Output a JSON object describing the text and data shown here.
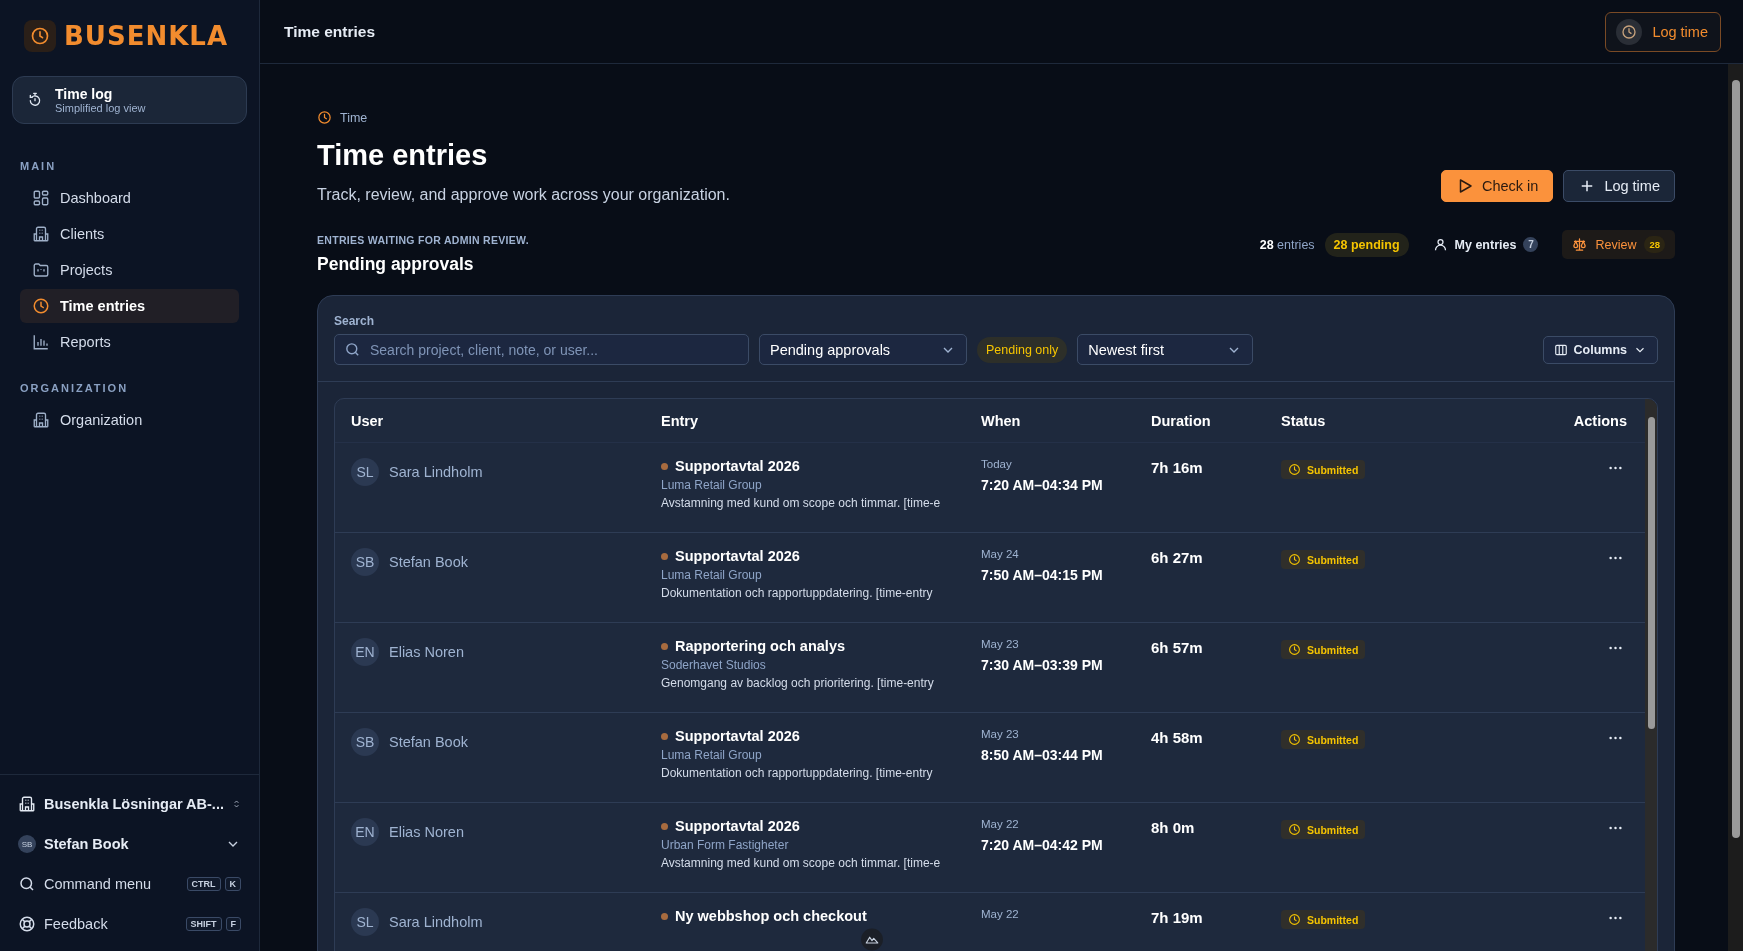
{
  "brand": {
    "name": "BUSENKLA"
  },
  "sidebar": {
    "feature_card": {
      "title": "Time log",
      "subtitle": "Simplified log view"
    },
    "sections": [
      {
        "heading": "MAIN",
        "items": [
          {
            "label": "Dashboard",
            "kind": "grid",
            "selected": false
          },
          {
            "label": "Clients",
            "kind": "building",
            "selected": false
          },
          {
            "label": "Projects",
            "kind": "folder",
            "selected": false
          },
          {
            "label": "Time entries",
            "kind": "clock",
            "selected": true
          },
          {
            "label": "Reports",
            "kind": "chart",
            "selected": false
          }
        ]
      },
      {
        "heading": "ORGANIZATION",
        "items": [
          {
            "label": "Organization",
            "kind": "building",
            "selected": false
          }
        ]
      }
    ],
    "org_switcher": "Busenkla Lösningar AB-...",
    "user": {
      "initials": "SB",
      "name": "Stefan Book"
    },
    "shortcuts": [
      {
        "label": "Command menu",
        "kind": "search",
        "keys": [
          "CTRL",
          "K"
        ]
      },
      {
        "label": "Feedback",
        "kind": "lifebuoy",
        "keys": [
          "SHIFT",
          "F"
        ]
      }
    ]
  },
  "header": {
    "title": "Time entries",
    "button": "Log time"
  },
  "page": {
    "eyebrow": "Time",
    "title": "Time entries",
    "subtitle": "Track, review, and approve work across your organization.",
    "primary_button": "Check in",
    "secondary_button": "Log time",
    "section_kicker": "ENTRIES WAITING FOR ADMIN REVIEW.",
    "section_title": "Pending approvals",
    "stats": {
      "count": "28",
      "count_label": "entries",
      "pending": "28 pending",
      "my_entries": "My entries",
      "my_count": "7",
      "review": "Review",
      "review_count": "28"
    }
  },
  "filters": {
    "search_label": "Search",
    "search_placeholder": "Search project, client, note, or user...",
    "view": "Pending approvals",
    "pending_only": "Pending only",
    "sort": "Newest first",
    "columns_button": "Columns"
  },
  "table": {
    "columns": [
      "User",
      "Entry",
      "When",
      "Duration",
      "Status",
      "Actions"
    ],
    "rows": [
      {
        "initials": "SL",
        "user": "Sara Lindholm",
        "project": "Supportavtal 2026",
        "color": "#a86b3f",
        "client": "Luma Retail Group",
        "note": "Avstamning med kund om scope och timmar. [time-e",
        "day": "Today",
        "time": "7:20 AM–04:34 PM",
        "duration": "7h 16m",
        "status": "Submitted"
      },
      {
        "initials": "SB",
        "user": "Stefan Book",
        "project": "Supportavtal 2026",
        "color": "#a86b3f",
        "client": "Luma Retail Group",
        "note": "Dokumentation och rapportuppdatering. [time-entry",
        "day": "May 24",
        "time": "7:50 AM–04:15 PM",
        "duration": "6h 27m",
        "status": "Submitted"
      },
      {
        "initials": "EN",
        "user": "Elias Noren",
        "project": "Rapportering och analys",
        "color": "#a86b3f",
        "client": "Soderhavet Studios",
        "note": "Genomgang av backlog och prioritering. [time-entry",
        "day": "May 23",
        "time": "7:30 AM–03:39 PM",
        "duration": "6h 57m",
        "status": "Submitted"
      },
      {
        "initials": "SB",
        "user": "Stefan Book",
        "project": "Supportavtal 2026",
        "color": "#a86b3f",
        "client": "Luma Retail Group",
        "note": "Dokumentation och rapportuppdatering. [time-entry",
        "day": "May 23",
        "time": "8:50 AM–03:44 PM",
        "duration": "4h 58m",
        "status": "Submitted"
      },
      {
        "initials": "EN",
        "user": "Elias Noren",
        "project": "Supportavtal 2026",
        "color": "#a86b3f",
        "client": "Urban Form Fastigheter",
        "note": "Avstamning med kund om scope och timmar. [time-e",
        "day": "May 22",
        "time": "7:20 AM–04:42 PM",
        "duration": "8h 0m",
        "status": "Submitted"
      },
      {
        "initials": "SL",
        "user": "Sara Lindholm",
        "project": "Ny webbshop och checkout",
        "color": "#a86b3f",
        "day": "May 22",
        "duration": "7h 19m",
        "status": "Submitted"
      }
    ]
  }
}
